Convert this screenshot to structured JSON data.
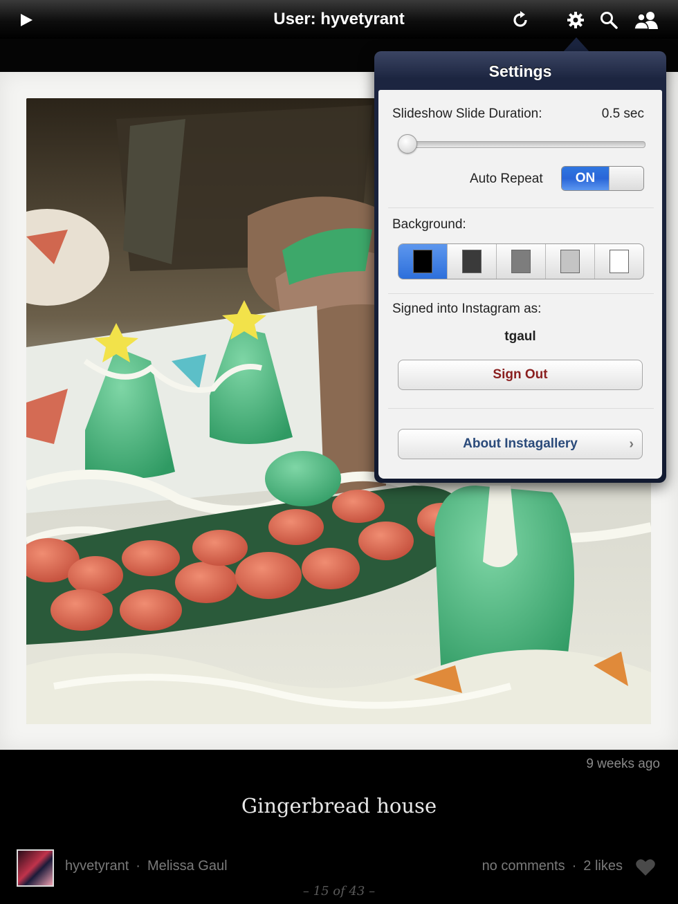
{
  "topbar": {
    "title": "User: hyvetyrant",
    "icons": [
      "play-icon",
      "refresh-icon",
      "gear-icon",
      "search-icon",
      "users-icon"
    ]
  },
  "photo": {
    "caption": "Gingerbread house",
    "timestamp": "9 weeks ago",
    "username": "hyvetyrant",
    "fullname": "Melissa Gaul",
    "separator": "·",
    "comments": "no comments",
    "likes": "2 likes",
    "pager": "– 15 of 43 –"
  },
  "settings": {
    "title": "Settings",
    "slide_duration_label": "Slideshow Slide Duration:",
    "slide_duration_value": "0.5 sec",
    "slide_duration_level": 0.0,
    "auto_repeat_label": "Auto Repeat",
    "auto_repeat_state": "ON",
    "background_label": "Background:",
    "background_options": [
      "#000000",
      "#3a3a3a",
      "#7d7d7d",
      "#c4c4c4",
      "#ffffff"
    ],
    "background_selected_index": 0,
    "signed_in_label": "Signed into Instagram as:",
    "signed_in_user": "tgaul",
    "sign_out_label": "Sign Out",
    "about_label": "About Instagallery"
  },
  "colors": {
    "accent": "#2a6ed9",
    "popover_dark": "#1c2540",
    "signout_red": "#8a1f1f"
  }
}
